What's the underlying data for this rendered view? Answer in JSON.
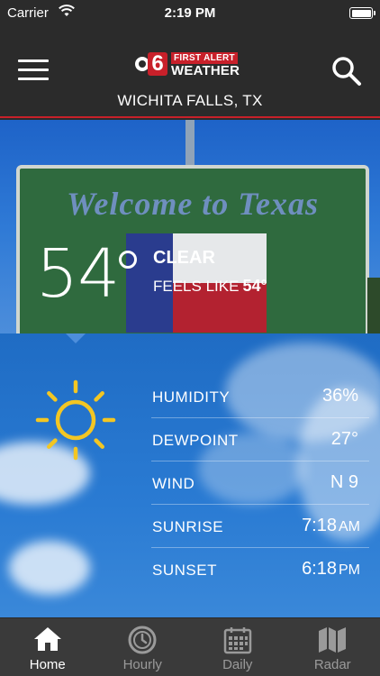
{
  "status_bar": {
    "carrier": "Carrier",
    "time": "2:19 PM"
  },
  "header": {
    "logo": {
      "number": "6",
      "line1": "FIRST ALERT",
      "line2": "WEATHER"
    },
    "location": "WICHITA FALLS, TX"
  },
  "photo": {
    "sign_text": "Welcome to Texas"
  },
  "current": {
    "temperature": "54",
    "condition": "CLEAR",
    "feels_like_label": "FEELS LIKE",
    "feels_like_value": "54°"
  },
  "details": [
    {
      "label": "HUMIDITY",
      "value": "36%",
      "unit": ""
    },
    {
      "label": "DEWPOINT",
      "value": "27°",
      "unit": ""
    },
    {
      "label": "WIND",
      "value": "N 9",
      "unit": ""
    },
    {
      "label": "SUNRISE",
      "value": "7:18",
      "unit": "AM"
    },
    {
      "label": "SUNSET",
      "value": "6:18",
      "unit": "PM"
    }
  ],
  "tabs": [
    {
      "label": "Home",
      "icon": "home-icon",
      "active": true
    },
    {
      "label": "Hourly",
      "icon": "clock-icon",
      "active": false
    },
    {
      "label": "Daily",
      "icon": "calendar-icon",
      "active": false
    },
    {
      "label": "Radar",
      "icon": "map-icon",
      "active": false
    }
  ],
  "colors": {
    "header_bg": "#2b2b2b",
    "accent_red": "#c8202a",
    "sun_yellow": "#f3c623",
    "tabbar_bg": "#3a3a3a"
  }
}
